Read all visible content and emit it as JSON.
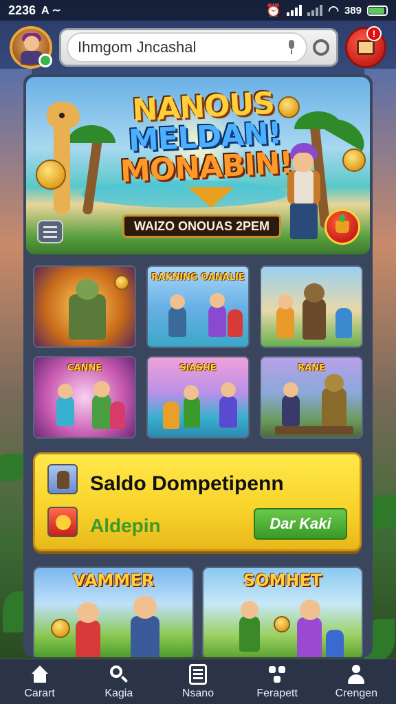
{
  "status_bar": {
    "time": "2236",
    "extra": "A ∼",
    "battery_text": "389",
    "battery_level": 0.8
  },
  "header": {
    "search_value": "Ihmgom Jncashal",
    "notification_badge": "!"
  },
  "hero": {
    "title_line1": "NANOUS",
    "title_line2": "MELDAN!",
    "title_line3": "MONABIN!",
    "caption": "WAIZO ONOUAS 2PEM"
  },
  "grid": {
    "cards": [
      {
        "title": ""
      },
      {
        "title": "RAKNING OANALIE"
      },
      {
        "title": ""
      },
      {
        "title": "CANNE"
      },
      {
        "title": "SIASHE"
      },
      {
        "title": "RANE"
      }
    ]
  },
  "wallet": {
    "title": "Saldo Dompetipenn",
    "subtitle": "Aldepin",
    "button_label": "Dar Kaki"
  },
  "bottom_cards": [
    {
      "title": "VAMMER"
    },
    {
      "title": "SOMHET"
    }
  ],
  "nav": {
    "items": [
      {
        "label": "Carart",
        "icon": "home-icon"
      },
      {
        "label": "Kagia",
        "icon": "search-icon"
      },
      {
        "label": "Nsano",
        "icon": "list-icon"
      },
      {
        "label": "Ferapett",
        "icon": "grid-dots-icon"
      },
      {
        "label": "Crengen",
        "icon": "profile-icon"
      }
    ]
  },
  "colors": {
    "accent_yellow": "#f8d22a",
    "accent_green": "#3a9a2a",
    "accent_red": "#c8201a",
    "panel_bg": "#3a465e"
  }
}
